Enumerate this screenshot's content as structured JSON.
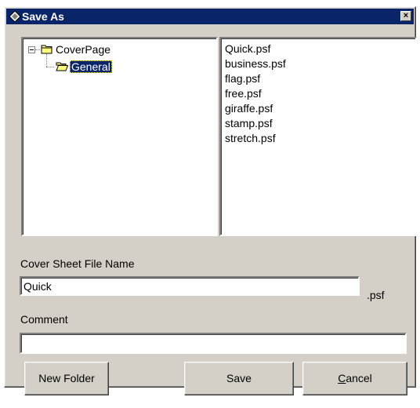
{
  "window": {
    "title": "Save As",
    "close_glyph": "×",
    "title_icon": "diamond-app-icon"
  },
  "tree": {
    "items": [
      {
        "label": "CoverPage",
        "icon": "folder-closed-icon",
        "expanded": true
      },
      {
        "label": "General",
        "icon": "folder-open-icon",
        "selected": true
      }
    ]
  },
  "files": {
    "items": [
      "Quick.psf",
      "business.psf",
      "flag.psf",
      "free.psf",
      "giraffe.psf",
      "stamp.psf",
      "stretch.psf"
    ]
  },
  "form": {
    "file_name_label": "Cover Sheet File Name",
    "file_name_value": "Quick",
    "extension_label": ".psf",
    "comment_label": "Comment",
    "comment_value": ""
  },
  "buttons": {
    "new_folder": "New Folder",
    "save": "Save",
    "cancel_prefix": "C",
    "cancel_rest": "ancel"
  },
  "colors": {
    "titlebar": "#0a246a",
    "face": "#d4d0c8",
    "selection": "#0a246a"
  }
}
